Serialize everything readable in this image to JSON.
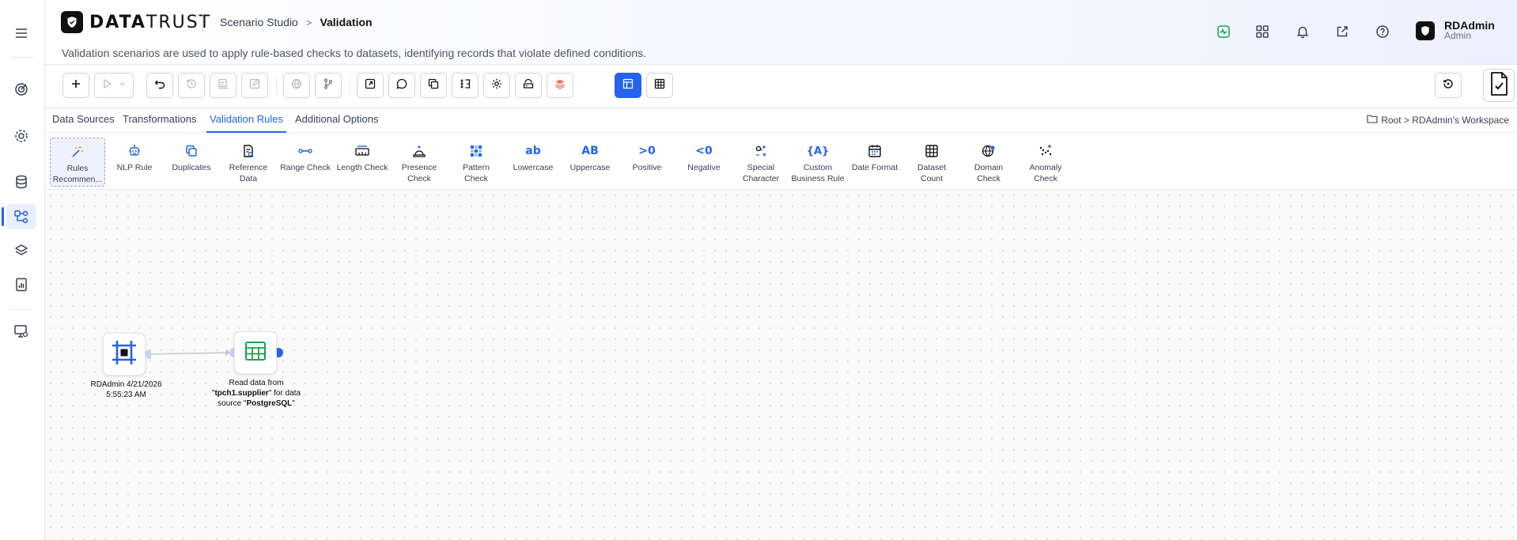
{
  "brand": {
    "name_bold": "DATA",
    "name_light": "TRUST"
  },
  "breadcrumb": {
    "parent": "Scenario Studio",
    "current": "Validation"
  },
  "description": "Validation scenarios are used to apply rule-based checks to datasets, identifying records that violate defined conditions.",
  "user": {
    "name": "RDAdmin",
    "role": "Admin"
  },
  "tabs": [
    {
      "label": "Data Sources",
      "active": false
    },
    {
      "label": "Transformations",
      "active": false
    },
    {
      "label": "Validation Rules",
      "active": true
    },
    {
      "label": "Additional Options",
      "active": false
    }
  ],
  "workspace": {
    "path": "Root > RDAdmin's Workspace"
  },
  "rules": [
    {
      "line1": "Rules",
      "line2": "Recommen...",
      "icon": "magic-wand-icon"
    },
    {
      "line1": "NLP Rule",
      "line2": "",
      "icon": "nlp-icon"
    },
    {
      "line1": "Duplicates",
      "line2": "",
      "icon": "duplicates-icon"
    },
    {
      "line1": "Reference",
      "line2": "Data",
      "icon": "reference-data-icon"
    },
    {
      "line1": "Range Check",
      "line2": "",
      "icon": "range-icon"
    },
    {
      "line1": "Length Check",
      "line2": "",
      "icon": "ruler-icon"
    },
    {
      "line1": "Presence",
      "line2": "Check",
      "icon": "presence-icon"
    },
    {
      "line1": "Pattern",
      "line2": "Check",
      "icon": "pattern-icon"
    },
    {
      "line1": "Lowercase",
      "line2": "",
      "icon": "lowercase-icon",
      "glyph": "ab"
    },
    {
      "line1": "Uppercase",
      "line2": "",
      "icon": "uppercase-icon",
      "glyph": "AB"
    },
    {
      "line1": "Positive",
      "line2": "",
      "icon": "positive-icon",
      "glyph": ">0"
    },
    {
      "line1": "Negative",
      "line2": "",
      "icon": "negative-icon",
      "glyph": "<0"
    },
    {
      "line1": "Special",
      "line2": "Character",
      "icon": "special-character-icon"
    },
    {
      "line1": "Custom",
      "line2": "Business Rule",
      "icon": "custom-rule-icon",
      "glyph": "{A}"
    },
    {
      "line1": "Date Format",
      "line2": "",
      "icon": "calendar-icon"
    },
    {
      "line1": "Dataset",
      "line2": "Count",
      "icon": "table-icon"
    },
    {
      "line1": "Domain",
      "line2": "Check",
      "icon": "globe-icon"
    },
    {
      "line1": "Anomaly",
      "line2": "Check",
      "icon": "anomaly-icon"
    }
  ],
  "nodes": {
    "start": {
      "label": "RDAdmin 4/21/2026 5:55:23 AM"
    },
    "source": {
      "prefix": "Read data from \"",
      "table": "tpch1.supplier",
      "middle": "\" for data source \"",
      "db": "PostgreSQL",
      "suffix": "\""
    }
  },
  "colors": {
    "accent": "#2563eb",
    "active_tab": "#2563eb",
    "layers_icon": "#f97362",
    "status_icon": "#16a34a"
  }
}
